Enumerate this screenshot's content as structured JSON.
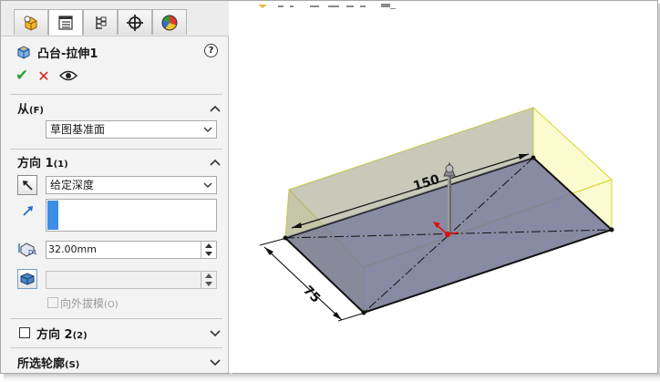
{
  "panel": {
    "tabs": [
      {
        "name": "feature-manager-tab",
        "icon": "feature-tree-icon"
      },
      {
        "name": "property-manager-tab",
        "icon": "property-list-icon"
      },
      {
        "name": "configuration-manager-tab",
        "icon": "configuration-icon"
      },
      {
        "name": "dimxpert-tab",
        "icon": "crosshair-icon"
      },
      {
        "name": "display-manager-tab",
        "icon": "color-wheel-icon"
      }
    ],
    "title": "凸台-拉伸1",
    "help": "?",
    "from_section": {
      "label": "从",
      "shortcut": "(F)",
      "select_value": "草图基准面"
    },
    "direction1_section": {
      "label": "方向 1",
      "shortcut": "(1)",
      "end_condition": "给定深度",
      "depth_value": "32.00mm",
      "draft_label": "向外拔模",
      "draft_shortcut": "(O)"
    },
    "direction2_section": {
      "label": "方向 2",
      "shortcut": "(2)"
    },
    "contours_section": {
      "label": "所选轮廓",
      "shortcut": "(S)"
    }
  },
  "viewport": {
    "dimension_length": "150",
    "dimension_width": "75"
  },
  "colors": {
    "extrude_preview": "#f5f59a",
    "sketch_face": "#6f7299",
    "list_selection": "#3d8ee8"
  }
}
